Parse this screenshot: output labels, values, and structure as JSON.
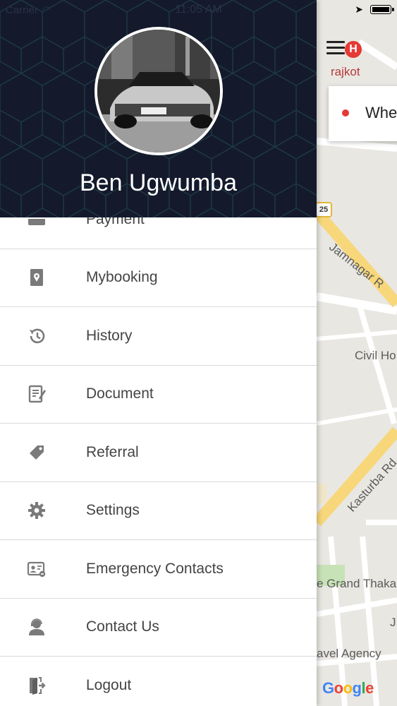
{
  "status_bar": {
    "carrier": "Carrier",
    "time": "11:05 AM"
  },
  "profile": {
    "name": "Ben Ugwumba"
  },
  "menu": {
    "items": [
      {
        "label": "Payment",
        "icon": "card-icon"
      },
      {
        "label": "Mybooking",
        "icon": "booking-pin-icon"
      },
      {
        "label": "History",
        "icon": "history-icon"
      },
      {
        "label": "Document",
        "icon": "document-icon"
      },
      {
        "label": "Referral",
        "icon": "tag-icon"
      },
      {
        "label": "Settings",
        "icon": "gear-icon"
      },
      {
        "label": "Emergency Contacts",
        "icon": "contact-card-icon"
      },
      {
        "label": "Contact Us",
        "icon": "support-agent-icon"
      },
      {
        "label": "Logout",
        "icon": "logout-icon"
      }
    ]
  },
  "map": {
    "city": "rajkot",
    "badge": "H",
    "search_placeholder": "Whe",
    "route_number": "25",
    "labels": [
      "Jamnagar R",
      "Civil Ho",
      "Kasturba Rd",
      "e Grand Thaka",
      "J",
      "avel Agency"
    ],
    "logo": "Google"
  },
  "colors": {
    "header_bg": "#141a2b",
    "accent_red": "#e53935",
    "road_yellow": "#f7d77a"
  }
}
